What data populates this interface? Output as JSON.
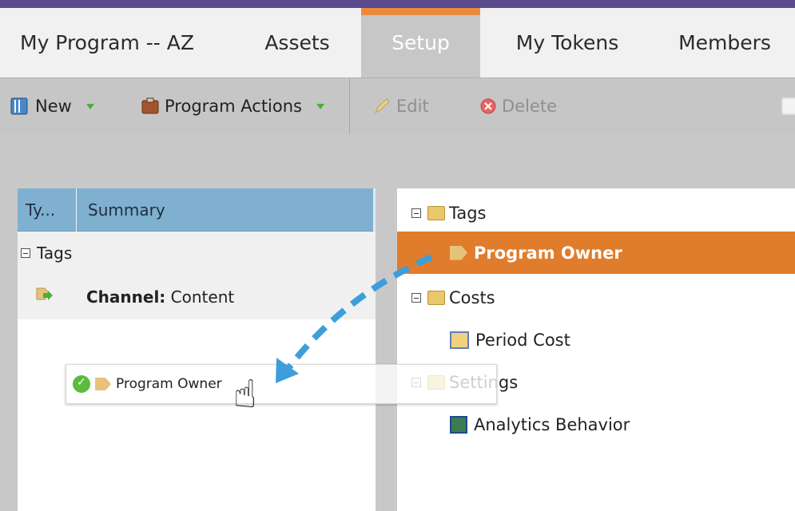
{
  "tabs": {
    "program": "My Program -- AZ",
    "assets": "Assets",
    "setup": "Setup",
    "tokens": "My Tokens",
    "members": "Members"
  },
  "toolbar": {
    "new_label": "New",
    "program_actions_label": "Program Actions",
    "edit_label": "Edit",
    "delete_label": "Delete"
  },
  "left_grid": {
    "col_type": "Ty...",
    "col_summary": "Summary",
    "group_tags": "Tags",
    "channel_label": "Channel:",
    "channel_value": " Content"
  },
  "right_tree": {
    "tags": "Tags",
    "program_owner": "Program Owner",
    "costs": "Costs",
    "period_cost": "Period Cost",
    "settings": "Settings",
    "analytics_behavior": "Analytics Behavior"
  },
  "drag": {
    "label": "Program Owner"
  },
  "colors": {
    "accent": "#e07d2c",
    "header": "#7fb0d0",
    "topbar": "#5c4b8c"
  }
}
